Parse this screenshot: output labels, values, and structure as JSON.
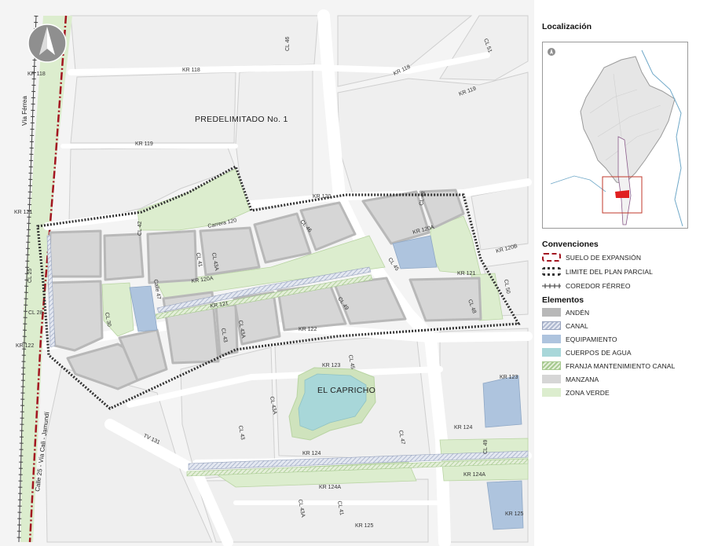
{
  "map": {
    "area_labels": {
      "predelimitado": "PREDELIMITADO No. 1",
      "el_capricho": "EL CAPRICHO"
    },
    "side_labels": {
      "via_ferrea": "Vía Férrea",
      "calle25": "Calle 25 - Vía Cali - Jamundí"
    },
    "street_labels": {
      "kr118_a": "KR 118",
      "kr118_b": "KR 118",
      "kr118_c": "KR 118",
      "cl46_a": "CL 46",
      "cl51": "CL 51",
      "kr119_a": "KR 119",
      "kr119_b": "KR 119",
      "kr121_a": "KR 121",
      "kr120": "KR 120",
      "carrera120": "Carrera 120",
      "cl48_a": "CL 48",
      "kr120a_a": "KR 120A",
      "kr120b": "KR 120B",
      "cl42": "CL 42",
      "cl43a_a": "CL 43A",
      "cl41": "CL 41",
      "cl46_b": "CL 46",
      "cl45_a": "CL 45",
      "cl50": "CL 50",
      "cl25": "CL 25",
      "calle47": "Calle 47",
      "kr120a_b": "KR 120A",
      "kr121_b": "KR 121",
      "kr121_c": "KR 121",
      "cl48_b": "CL 48",
      "cl28": "CL 28",
      "cl30": "CL 30",
      "cl43_a": "CL 43",
      "cl43a_b": "CL 43A",
      "cl49": "CL 49",
      "kr122_a": "KR 122",
      "kr122_b": "KR 122",
      "kr123_a": "KR 123",
      "cl45_b": "CL 45",
      "kr123_b": "KR 123",
      "cl43a_c": "CL 43A",
      "cl43_b": "CL 43",
      "cl47": "CL 47",
      "kr124_a": "KR 124",
      "kr124_b": "KR 124",
      "cl49b": "CL 49",
      "tv131": "TV 131",
      "kr124a_a": "KR 124A",
      "kr124a_b": "KR 124A",
      "cl43a_d": "CL 43A",
      "cl41b": "CL 41",
      "kr125_a": "KR 125",
      "kr125_b": "KR 125"
    }
  },
  "panel": {
    "localizacion_title": "Localización",
    "convenciones_title": "Convenciones",
    "elementos_title": "Elementos",
    "convenciones": [
      {
        "label": "SUELO DE EXPANSIÓN",
        "type": "suelo"
      },
      {
        "label": "LIMITE DEL PLAN PARCIAL",
        "type": "limite"
      },
      {
        "label": "COREDOR FÉRREO",
        "type": "ferreo"
      }
    ],
    "elementos": [
      {
        "label": "ANDÉN",
        "type": "andes"
      },
      {
        "label": "CANAL",
        "type": "canal"
      },
      {
        "label": "EQUIPAMIENTO",
        "type": "equip"
      },
      {
        "label": "CUERPOS DE AGUA",
        "type": "cuerpos"
      },
      {
        "label": "FRANJA MANTENIMIENTO CANAL",
        "type": "franja"
      },
      {
        "label": "MANZANA",
        "type": "manzana"
      },
      {
        "label": "ZONA VERDE",
        "type": "zona"
      }
    ]
  },
  "colors": {
    "block": "#d6d6d6",
    "sidewalk": "#b8b8b8",
    "green": "#dcedce",
    "water": "#a8d7d9",
    "equipment": "#aec4de",
    "expansion_border": "#a31520",
    "boundary": "#333333"
  }
}
